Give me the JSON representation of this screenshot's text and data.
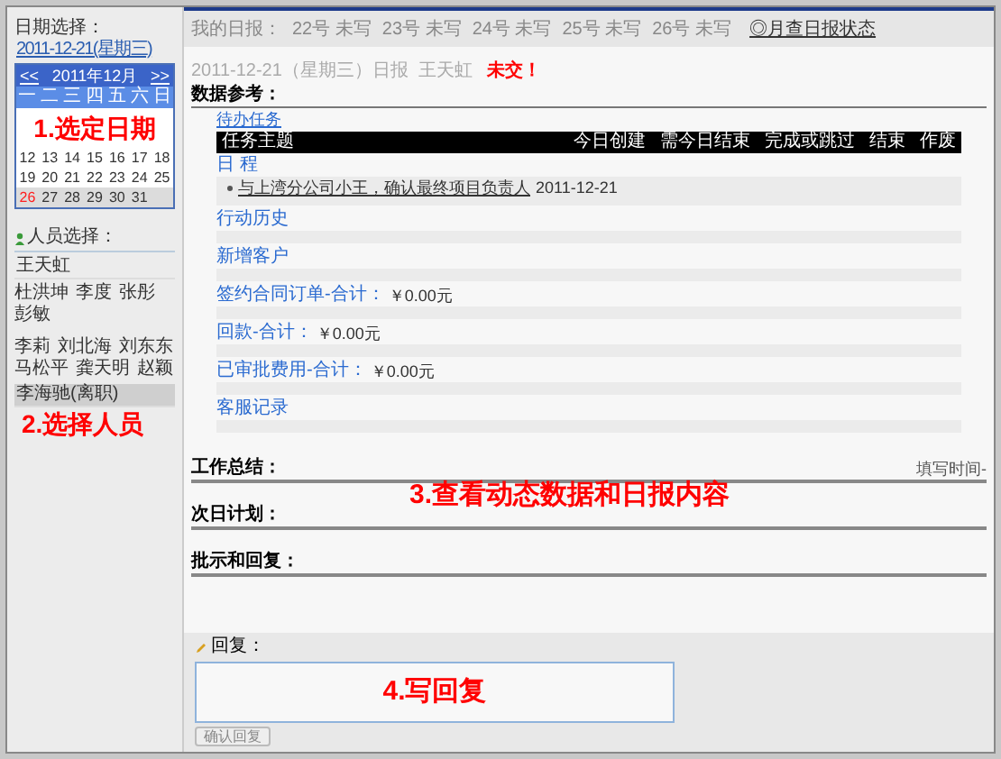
{
  "sidebar": {
    "date_label": "日期选择：",
    "date_link": "2011-12-21(星期三)",
    "calendar": {
      "prev": "<<",
      "month": "2011年12月",
      "next": ">>",
      "weekdays": [
        "一",
        "二",
        "三",
        "四",
        "五",
        "六",
        "日"
      ],
      "weeks": [
        {
          "shaded": false,
          "days": [
            {
              "label": "12",
              "today": false
            },
            {
              "label": "13",
              "today": false
            },
            {
              "label": "14",
              "today": false
            },
            {
              "label": "15",
              "today": false
            },
            {
              "label": "16",
              "today": false
            },
            {
              "label": "17",
              "today": false
            },
            {
              "label": "18",
              "today": false
            }
          ]
        },
        {
          "shaded": false,
          "days": [
            {
              "label": "19",
              "today": false
            },
            {
              "label": "20",
              "today": false
            },
            {
              "label": "21",
              "today": false
            },
            {
              "label": "22",
              "today": false
            },
            {
              "label": "23",
              "today": false
            },
            {
              "label": "24",
              "today": false
            },
            {
              "label": "25",
              "today": false
            }
          ]
        },
        {
          "shaded": true,
          "days": [
            {
              "label": "26",
              "today": true
            },
            {
              "label": "27",
              "today": false
            },
            {
              "label": "28",
              "today": false
            },
            {
              "label": "29",
              "today": false
            },
            {
              "label": "30",
              "today": false
            },
            {
              "label": "31",
              "today": false
            }
          ]
        }
      ]
    },
    "people_label": "人员选择：",
    "people": [
      {
        "kind": "lead",
        "name": "王天虹",
        "selected": false
      },
      {
        "kind": "member",
        "name": "杜洪坤",
        "selected": false
      },
      {
        "kind": "member",
        "name": "李度",
        "selected": false
      },
      {
        "kind": "member",
        "name": "张彤",
        "selected": false
      },
      {
        "kind": "member",
        "name": "彭敏",
        "selected": false
      },
      {
        "kind": "break"
      },
      {
        "kind": "member",
        "name": "李莉",
        "selected": false
      },
      {
        "kind": "member",
        "name": "刘北海",
        "selected": false
      },
      {
        "kind": "member",
        "name": "刘东东",
        "selected": false
      },
      {
        "kind": "member",
        "name": "马松平",
        "selected": false
      },
      {
        "kind": "member",
        "name": "龚天明",
        "selected": false
      },
      {
        "kind": "member",
        "name": "赵颖",
        "selected": false
      },
      {
        "kind": "lead",
        "name": "李海驰(离职)",
        "selected": true
      }
    ]
  },
  "top_bar": {
    "label": "我的日报：",
    "days": [
      {
        "day": "22号",
        "status": "未写"
      },
      {
        "day": "23号",
        "status": "未写"
      },
      {
        "day": "24号",
        "status": "未写"
      },
      {
        "day": "25号",
        "status": "未写"
      },
      {
        "day": "26号",
        "status": "未写"
      }
    ],
    "month_link": "◎月查日报状态"
  },
  "report": {
    "title": "2011-12-21（星期三）日报  王天虹",
    "status": "未交！",
    "data_heading": "数据参考：",
    "task_link": "待办任务",
    "task_columns": [
      "任务主题",
      "今日创建",
      "需今日结束",
      "完成或跳过",
      "结束",
      "作废"
    ],
    "schedule_label": "日 程",
    "schedule_items": [
      {
        "text": "与上湾分公司小王，确认最终项目负责人",
        "date": "2011-12-21"
      }
    ],
    "sections": [
      {
        "label": "行动历史"
      },
      {
        "label": "新增客户"
      },
      {
        "label": "签约合同订单-合计：",
        "value": "￥0.00元"
      },
      {
        "label": "回款-合计：",
        "value": "￥0.00元"
      },
      {
        "label": "已审批费用-合计：",
        "value": "￥0.00元"
      },
      {
        "label": "客服记录"
      }
    ],
    "summary": "工作总结：",
    "fill_time": "填写时间-",
    "plan": "次日计划：",
    "comments": "批示和回复："
  },
  "reply": {
    "label": "回复：",
    "button": "确认回复"
  },
  "annotations": [
    "1.选定日期",
    "2.选择人员",
    "3.查看动态数据和日报内容",
    "4.写回复"
  ]
}
